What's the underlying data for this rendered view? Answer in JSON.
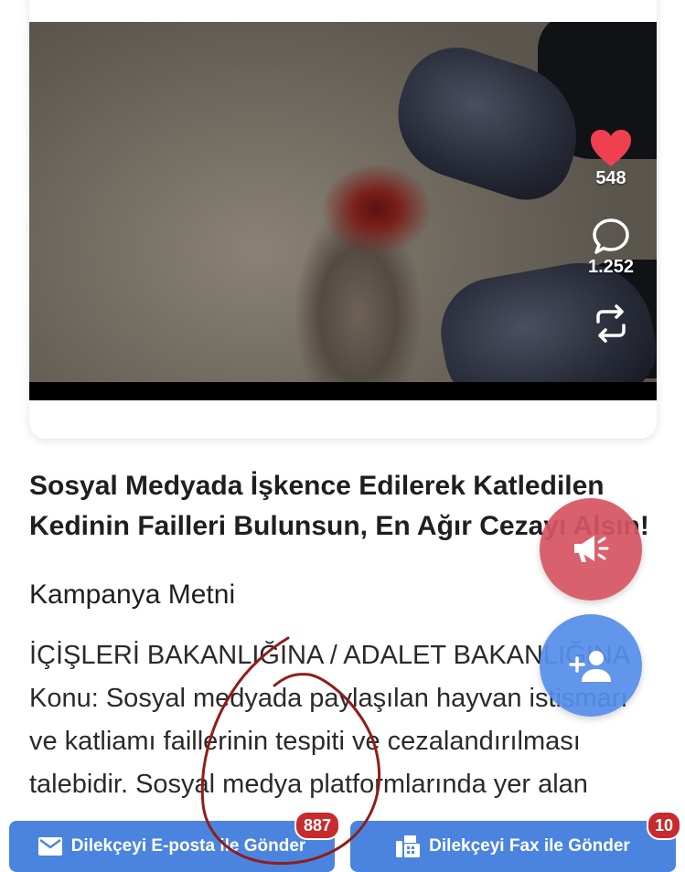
{
  "video": {
    "like_count": "548",
    "comment_count": "1.252",
    "icons": [
      "heart-icon",
      "comment-icon",
      "repost-icon"
    ],
    "heart_color": "#f04050"
  },
  "campaign": {
    "title": "Sosyal Medyada İşkence Edilerek Katledilen Kedinin Failleri Bulunsun, En Ağır Cezayı Alsın!",
    "section_heading": "Kampanya Metni",
    "addressee": "İÇİŞLERİ BAKANLIĞINA / ADALET BAKANLIĞINA",
    "body": "Konu: Sosyal medyada paylaşılan hayvan istismarı ve katliamı faillerinin tespiti ve cezalandırılması talebidir. Sosyal medya platformlarında yer alan"
  },
  "fabs": {
    "megaphone_icon": "megaphone-icon",
    "follow_icon": "add-person-icon",
    "megaphone_color": "#d65563",
    "follow_color": "#568ee8"
  },
  "actions": {
    "email_button_label": "Dilekçeyi E-posta ile Gönder",
    "email_count": "887",
    "fax_button_label": "Dilekçeyi Fax ile Gönder",
    "fax_count": "10",
    "button_color": "#4b84df",
    "badge_color": "#c62b2e"
  }
}
